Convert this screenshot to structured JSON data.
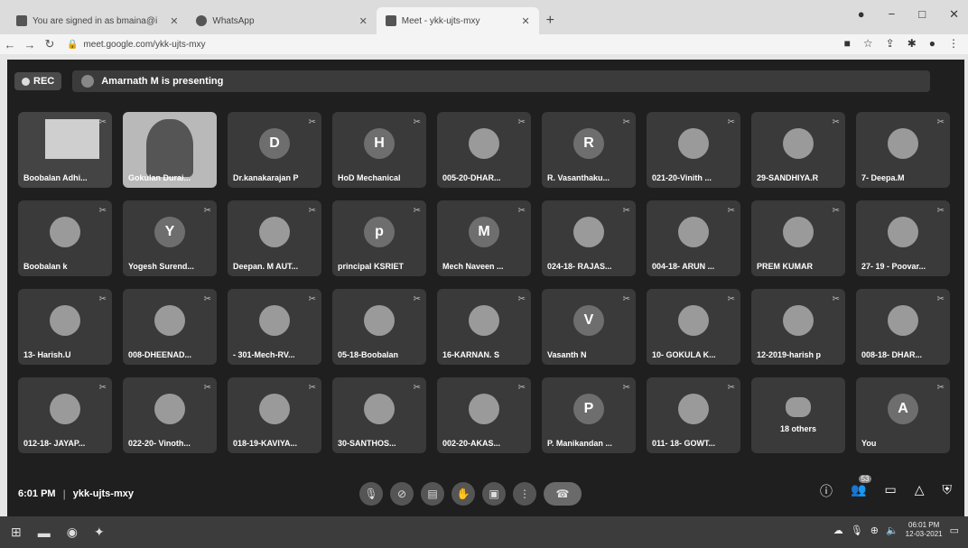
{
  "browser": {
    "tabs": [
      {
        "label": "You are signed in as bmaina@i",
        "active": false
      },
      {
        "label": "WhatsApp",
        "active": false
      },
      {
        "label": "Meet - ykk-ujts-mxy",
        "active": true
      }
    ],
    "url": "meet.google.com/ykk-ujts-mxy"
  },
  "meet": {
    "rec_label": "REC",
    "presenting_text": "Amarnath M is presenting",
    "participants": [
      {
        "name": "Boobalan Adhi...",
        "initial": "",
        "type": "screen"
      },
      {
        "name": "Gokulan Durai...",
        "initial": "",
        "type": "video"
      },
      {
        "name": "Dr.kanakarajan P",
        "initial": "D",
        "type": "initial"
      },
      {
        "name": "HoD Mechanical",
        "initial": "H",
        "type": "initial"
      },
      {
        "name": "005-20-DHAR...",
        "initial": "",
        "type": "image"
      },
      {
        "name": "R. Vasanthaku...",
        "initial": "R",
        "type": "initial"
      },
      {
        "name": "021-20-Vinith ...",
        "initial": "",
        "type": "image"
      },
      {
        "name": "29-SANDHIYA.R",
        "initial": "",
        "type": "image"
      },
      {
        "name": "7- Deepa.M",
        "initial": "",
        "type": "image"
      },
      {
        "name": "Boobalan k",
        "initial": "",
        "type": "image"
      },
      {
        "name": "Yogesh Surend...",
        "initial": "Y",
        "type": "initial"
      },
      {
        "name": "Deepan. M AUT...",
        "initial": "",
        "type": "image"
      },
      {
        "name": "principal KSRIET",
        "initial": "p",
        "type": "initial"
      },
      {
        "name": "Mech Naveen ...",
        "initial": "M",
        "type": "initial"
      },
      {
        "name": "024-18- RAJAS...",
        "initial": "",
        "type": "image"
      },
      {
        "name": "004-18- ARUN ...",
        "initial": "",
        "type": "image"
      },
      {
        "name": "PREM KUMAR",
        "initial": "",
        "type": "image"
      },
      {
        "name": "27- 19 - Poovar...",
        "initial": "",
        "type": "image"
      },
      {
        "name": "13- Harish.U",
        "initial": "",
        "type": "image"
      },
      {
        "name": "008-DHEENAD...",
        "initial": "",
        "type": "image"
      },
      {
        "name": "- 301-Mech-RV...",
        "initial": "",
        "type": "image"
      },
      {
        "name": "05-18-Boobalan",
        "initial": "",
        "type": "image"
      },
      {
        "name": "16-KARNAN. S",
        "initial": "",
        "type": "image"
      },
      {
        "name": "Vasanth N",
        "initial": "V",
        "type": "initial"
      },
      {
        "name": "10- GOKULA K...",
        "initial": "",
        "type": "image"
      },
      {
        "name": "12-2019-harish p",
        "initial": "",
        "type": "image"
      },
      {
        "name": "008-18- DHAR...",
        "initial": "",
        "type": "image"
      },
      {
        "name": "012-18- JAYAP...",
        "initial": "",
        "type": "image"
      },
      {
        "name": "022-20- Vinoth...",
        "initial": "",
        "type": "image"
      },
      {
        "name": "018-19-KAVIYA...",
        "initial": "",
        "type": "image"
      },
      {
        "name": "30-SANTHOS...",
        "initial": "",
        "type": "image"
      },
      {
        "name": "002-20-AKAS...",
        "initial": "",
        "type": "image"
      },
      {
        "name": "P. Manikandan ...",
        "initial": "P",
        "type": "initial"
      },
      {
        "name": "011- 18- GOWT...",
        "initial": "",
        "type": "image"
      },
      {
        "name": "18 others",
        "initial": "",
        "type": "others"
      },
      {
        "name": "You",
        "initial": "A",
        "type": "initial"
      }
    ],
    "clock": "6:01 PM",
    "meeting_code": "ykk-ujts-mxy",
    "participants_count": "53"
  },
  "taskbar": {
    "time": "06:01 PM",
    "date": "12-03-2021"
  }
}
